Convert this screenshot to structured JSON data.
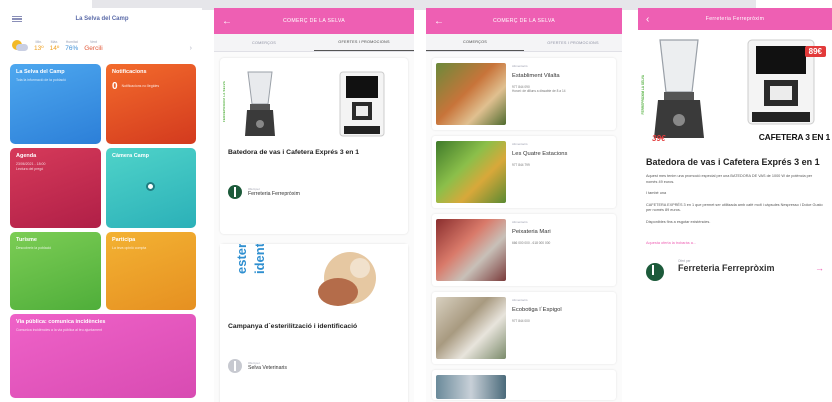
{
  "home": {
    "title": "La Selva del Camp",
    "weather": [
      {
        "label": "Min.",
        "value": "13º",
        "color": "#f0a020"
      },
      {
        "label": "Màx.",
        "value": "14º",
        "color": "#f0a020"
      },
      {
        "label": "Humitat",
        "value": "76%",
        "color": "#3d8fd6"
      },
      {
        "label": "Vent",
        "value": "Gercili",
        "color": "#e25a3a"
      }
    ],
    "tiles": {
      "town": {
        "title": "La Selva del Camp",
        "sub": "Tota la informació de la població"
      },
      "notifications": {
        "title": "Notificacions",
        "count": "0",
        "sub": "Notificacions no llegides"
      },
      "agenda": {
        "title": "Agenda",
        "date": "23/06/2021 - 18:00",
        "sub": "Lectura del pregó"
      },
      "webcam": {
        "title": "Càmera Camp"
      },
      "tourism": {
        "title": "Turisme",
        "sub": "Descobreix la població"
      },
      "participa": {
        "title": "Participa",
        "sub": "La teva opinió compta"
      },
      "public_road": {
        "title": "Via pública: comunica incidències",
        "sub": "Comunica incidències a la via pública al teu ajuntament"
      }
    }
  },
  "commerce_header": "COMERÇ DE LA SELVA",
  "tabs": {
    "first": "COMERÇOS",
    "second": "OFERTES I PROMOCIONS"
  },
  "offers": {
    "brand_strip": "FERREPROXIM LA SELVA",
    "promo1_title": "Batedora de vas i Cafetera Exprés 3 en 1",
    "promo1_seller_label": "Ofert per",
    "promo1_seller": "Ferreteria Ferrepròxim",
    "promo2_title": "Campanya d´esterilització i identificació",
    "promo2_seller_label": "Ofert per",
    "promo2_seller": "Selva Veterinaris",
    "promo2_banner": [
      "esterilitza",
      "identifica"
    ],
    "price_tag": "89€"
  },
  "shops": [
    {
      "category": "Alimentació",
      "name": "Establiment Vilalta",
      "tel": "977 844 090",
      "extra": "Horari: de dilluns a dissabte de 8 a 14"
    },
    {
      "category": "Alimentació",
      "name": "Les Quatre Estacions",
      "tel": "977 844 799"
    },
    {
      "category": "Alimentació",
      "name": "Peixateria Mari",
      "tel": "666 000 000 - 618 000 000"
    },
    {
      "category": "Alimentació",
      "name": "Ecobotiga l´Espigol",
      "tel": "977 844 000"
    }
  ],
  "detail": {
    "header": "Ferreteria Ferrepròxim",
    "price_left": "39€",
    "price_right": "89€",
    "product_caption": "CAFETERA 3 EN 1",
    "title": "Batedora de vas i Cafetera Exprés 3 en 1",
    "p1": "Aquest mes tenim una promoció especial per una BATEDORA DE VAS de 1000 W de potència per només 49 euros.",
    "p2": "I també una",
    "p3": "CAFETERA EXPRÉS 3 en 1 que permet ser utilitzada amb cafè molt i càpsules Nespresso i Dolce Gusto per només 89 euros.",
    "p4": "Disponibles fins a esgotar existències.",
    "link": "Aquesta oferta la trobaràs a...",
    "seller_label": "Ofert per",
    "seller": "Ferreteria Ferrepròxim"
  },
  "colors": {
    "brand": "#ee5fb3",
    "accent_green": "#4fae3a"
  }
}
